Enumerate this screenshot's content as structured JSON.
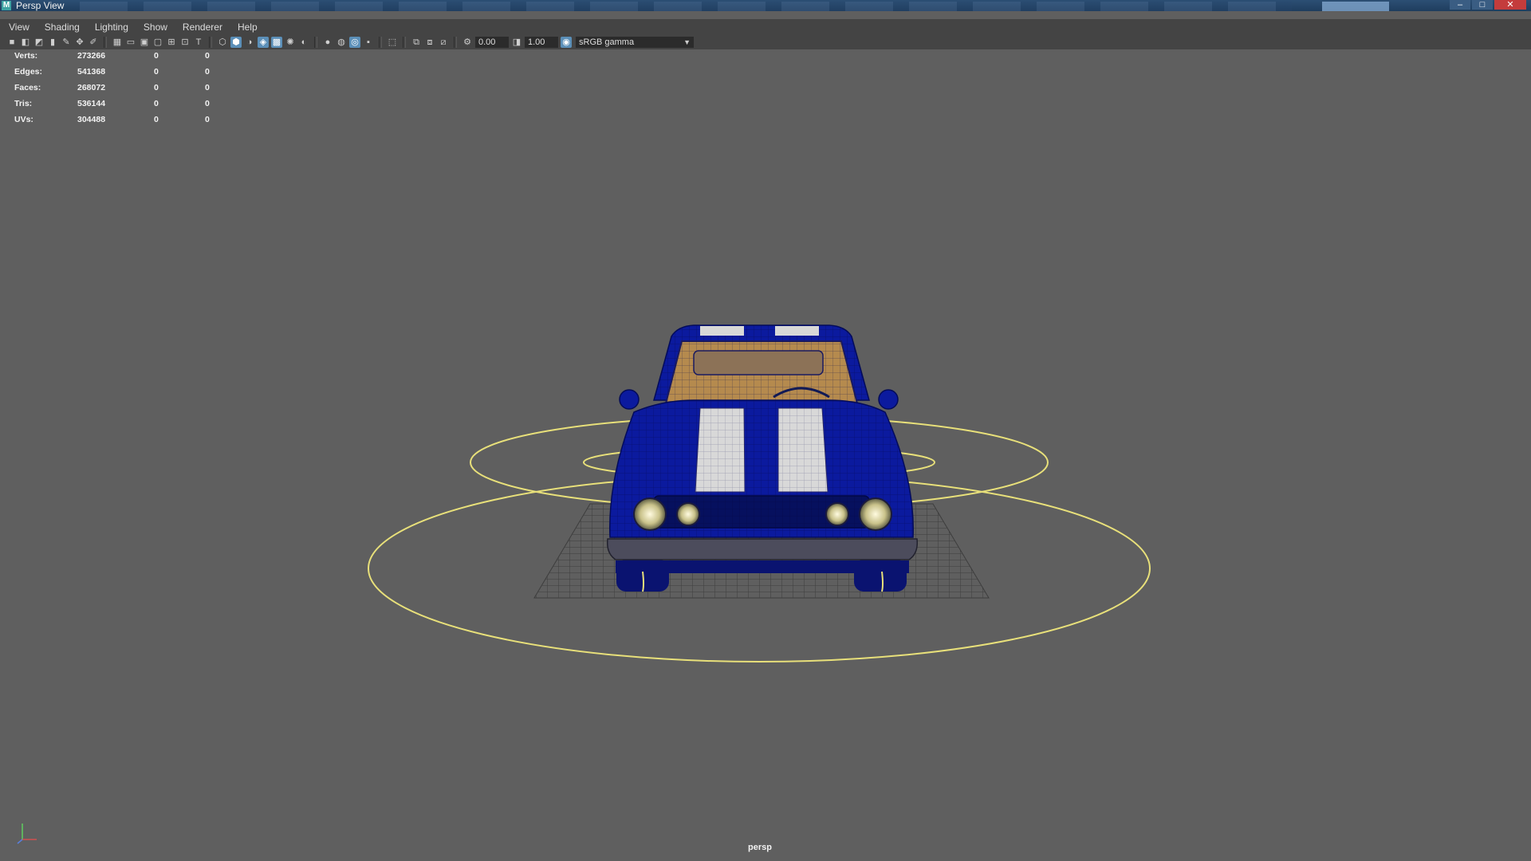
{
  "window": {
    "title": "Persp View",
    "app_icon_glyph": "M",
    "controls": [
      "–",
      "□",
      "✕"
    ]
  },
  "menu": {
    "items": [
      "View",
      "Shading",
      "Lighting",
      "Show",
      "Renderer",
      "Help"
    ]
  },
  "toolbar": {
    "exposure_value": "0.00",
    "gamma_value": "1.00",
    "color_space": "sRGB gamma",
    "icons": [
      "camera-icon",
      "camera-attributes-icon",
      "bookmark-icon",
      "image-plane-icon",
      "grease-pencil-icon",
      "2d-pan-zoom-icon",
      "grid-icon",
      "film-gate-icon",
      "resolution-gate-icon",
      "gate-mask-icon",
      "field-chart-icon",
      "safe-action-icon",
      "safe-title-icon",
      "wireframe-icon",
      "smooth-shade-icon",
      "default-material-icon",
      "wireframe-on-shaded-icon",
      "textured-icon",
      "use-lights-icon",
      "shadows-icon",
      "screen-space-ao-icon",
      "motion-blur-icon",
      "anti-aliasing-icon",
      "depth-of-field-icon",
      "isolate-select-icon",
      "xray-icon",
      "xray-active-components-icon",
      "xray-joints-icon",
      "exposure-icon",
      "gamma-icon",
      "color-management-icon"
    ]
  },
  "hud": {
    "rows": [
      {
        "label": "Verts:",
        "values": [
          "273266",
          "0",
          "0"
        ]
      },
      {
        "label": "Edges:",
        "values": [
          "541368",
          "0",
          "0"
        ]
      },
      {
        "label": "Faces:",
        "values": [
          "268072",
          "0",
          "0"
        ]
      },
      {
        "label": "Tris:",
        "values": [
          "536144",
          "0",
          "0"
        ]
      },
      {
        "label": "UVs:",
        "values": [
          "304488",
          "0",
          "0"
        ]
      }
    ]
  },
  "viewport": {
    "camera_name": "persp",
    "background_color": "#5f5f5f",
    "car_body_color": "#0b1a9e",
    "stripe_color": "#d8d8d8",
    "control_curve_color": "#e8e07a",
    "grid_color": "#3a3a3a"
  }
}
